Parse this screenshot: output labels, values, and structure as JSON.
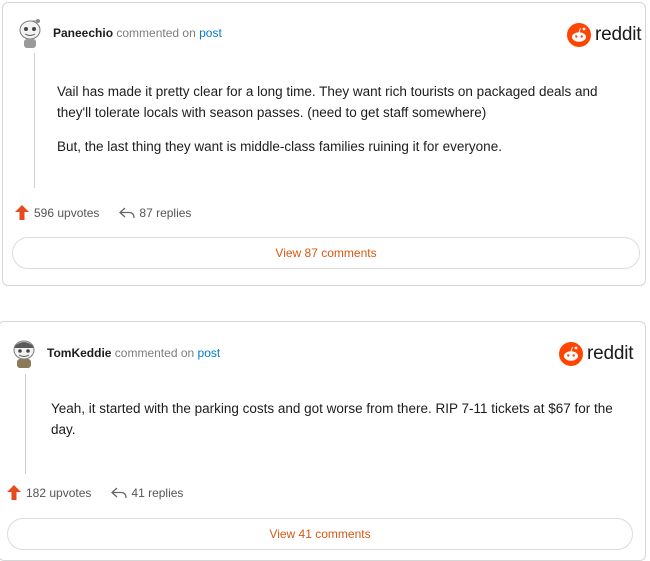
{
  "comments": [
    {
      "username": "Paneechio",
      "action_text": "commented on",
      "post_link": "post",
      "logo_text": "reddit",
      "paragraphs": [
        "Vail has made it pretty clear for a long time. They want rich tourists on packaged deals and they'll tolerate locals with season passes. (need to get staff somewhere)",
        "But, the last thing they want is middle-class families ruining it for everyone."
      ],
      "upvotes": "596 upvotes",
      "replies": "87 replies",
      "view_button": "View 87 comments"
    },
    {
      "username": "TomKeddie",
      "action_text": "commented on",
      "post_link": "post",
      "logo_text": "reddit",
      "paragraphs": [
        "Yeah, it started with the parking costs and got worse from there. RIP 7-11 tickets at $67 for the day."
      ],
      "upvotes": "182 upvotes",
      "replies": "41 replies",
      "view_button": "View 41 comments"
    }
  ],
  "colors": {
    "reddit_orange": "#ff4500",
    "upvote_red": "#e8491d",
    "link_blue": "#0079d3",
    "view_text": "#d45a13"
  }
}
